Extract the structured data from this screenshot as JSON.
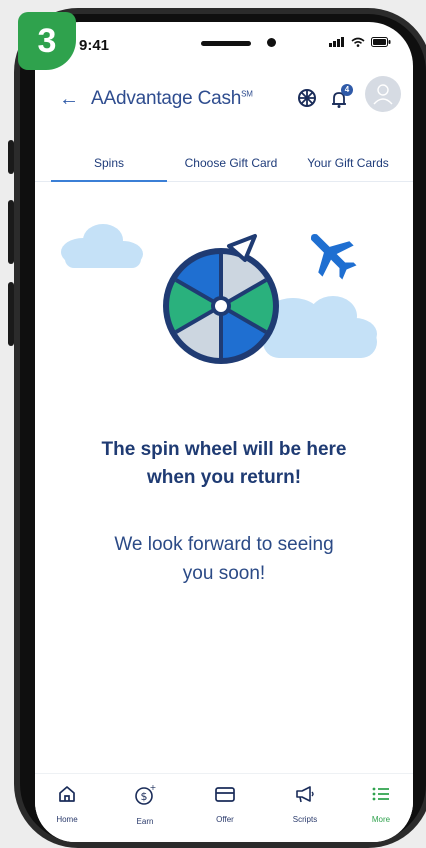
{
  "step_badge": "3",
  "status_bar": {
    "time": "9:41"
  },
  "header": {
    "back_icon": "arrow-left-icon",
    "title": "AAdvantage Cash",
    "title_mark": "SM",
    "icons": [
      "wheel-icon",
      "bell-icon"
    ],
    "notification_count": "4"
  },
  "tabs": [
    {
      "label": "Spins",
      "active": true
    },
    {
      "label": "Choose Gift Card",
      "active": false
    },
    {
      "label": "Your Gift Cards",
      "active": false
    }
  ],
  "message": {
    "headline_line1": "The spin wheel will be here",
    "headline_line2": "when you return!",
    "sub_line1": "We look forward to seeing",
    "sub_line2": "you soon!"
  },
  "bottom_nav": [
    {
      "label": "Home",
      "icon": "home-icon",
      "active": false
    },
    {
      "label": "Earn",
      "icon": "dollar-plus-icon",
      "active": false
    },
    {
      "label": "Offer",
      "icon": "card-icon",
      "active": false
    },
    {
      "label": "Scripts",
      "icon": "megaphone-icon",
      "active": false
    },
    {
      "label": "More",
      "icon": "list-icon",
      "active": true
    }
  ],
  "colors": {
    "accent_green": "#2fa24d",
    "brand_blue": "#1f3b73",
    "tab_active": "#3b7fd6"
  }
}
